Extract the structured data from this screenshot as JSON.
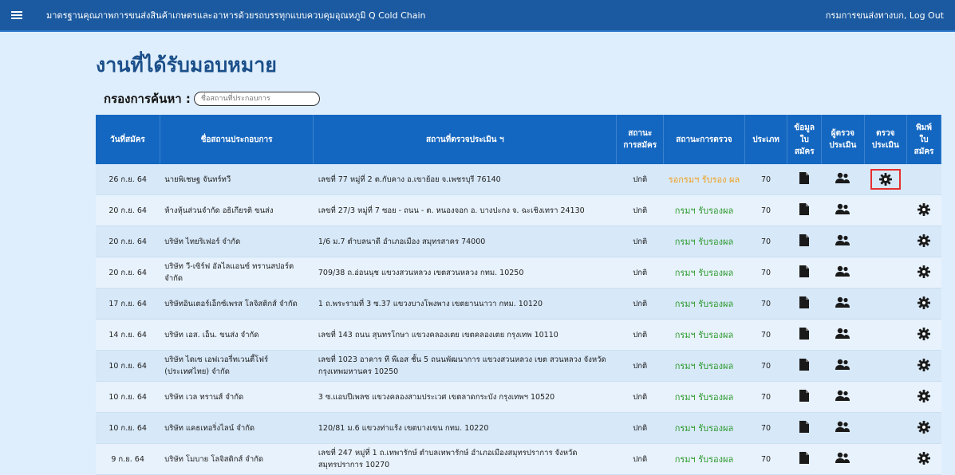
{
  "header": {
    "title": "มาตรฐานคุณภาพการขนส่งสินค้าเกษตรและอาหารด้วยรถบรรทุกแบบควบคุมอุณหภูมิ Q Cold Chain",
    "org": "กรมการขนส่งทางบก",
    "logout": "Log Out",
    "separator": ", "
  },
  "page": {
    "title": "งานที่ได้รับมอบหมาย",
    "filter_label": "กรองการค้นหา :",
    "search_placeholder": "ชื่อสถานที่ประกอบการ"
  },
  "table": {
    "headers": [
      "วันที่สมัคร",
      "ชื่อสถานประกอบการ",
      "สถานที่ตรวจประเมิน ฯ",
      "สถานะ การสมัคร",
      "สถานะการตรวจ",
      "ประเภท",
      "ข้อมูล ใบ สมัคร",
      "ผู้ตรวจ ประเมิน",
      "ตรวจ ประเมิน",
      "พิมพ์ ใบ สมัคร"
    ],
    "rows": [
      {
        "date": "26 ก.ย. 64",
        "company": "นายพิเชษฐ จันทร์ทวี",
        "address": "เลขที่ 77 หมู่ที่ 2 ต.กับคาง อ.เขาย้อย จ.เพชรบุรี 76140",
        "app_status": "ปกติ",
        "inspect_status": "รอกรมฯ รับรอง ผล",
        "type": "70",
        "can_inspect": true,
        "can_print": false
      },
      {
        "date": "20 ก.ย. 64",
        "company": "ห้างหุ้นส่วนจำกัด อธิเกียรติ ขนส่ง",
        "address": "เลขที่ 27/3 หมู่ที่ 7 ซอย - ถนน - ต. หนองจอก อ. บางปะกง จ. ฉะเชิงเทรา 24130",
        "app_status": "ปกติ",
        "inspect_status": "กรมฯ รับรองผล",
        "type": "70",
        "can_inspect": false,
        "can_print": true
      },
      {
        "date": "20 ก.ย. 64",
        "company": "บริษัท ไทยริเฟอร์ จำกัด",
        "address": "1/6 ม.7 ตำบลนาดี อำเภอเมือง สมุทรสาคร 74000",
        "app_status": "ปกติ",
        "inspect_status": "กรมฯ รับรองผล",
        "type": "70",
        "can_inspect": false,
        "can_print": true
      },
      {
        "date": "20 ก.ย. 64",
        "company": "บริษัท วี-เซิร์ฟ อัลไลแอนซ์ ทรานสปอร์ต จำกัด",
        "address": "709/38 ถ.อ่อนนุช แขวงสวนหลวง เขตสวนหลวง กทม. 10250",
        "app_status": "ปกติ",
        "inspect_status": "กรมฯ รับรองผล",
        "type": "70",
        "can_inspect": false,
        "can_print": true
      },
      {
        "date": "17 ก.ย. 64",
        "company": "บริษัทอินเตอร์เอ็กซ์เพรส โลจิสติกส์ จำกัด",
        "address": "1 ถ.พระรามที่ 3 ซ.37 แขวงบางโพงพาง เขตยานนาวา กทม. 10120",
        "app_status": "ปกติ",
        "inspect_status": "กรมฯ รับรองผล",
        "type": "70",
        "can_inspect": false,
        "can_print": true
      },
      {
        "date": "14 ก.ย. 64",
        "company": "บริษัท เอส. เอ็น. ขนส่ง จำกัด",
        "address": "เลขที่ 143 ถนน สุนทรโกษา แขวงคลองเตย เขตคลองเตย กรุงเทพ 10110",
        "app_status": "ปกติ",
        "inspect_status": "กรมฯ รับรองผล",
        "type": "70",
        "can_inspect": false,
        "can_print": true
      },
      {
        "date": "10 ก.ย. 64",
        "company": "บริษัท ไดเซ เอฟเวอรี่ทเวนตี้โฟร์ (ประเทศไทย) จำกัด",
        "address": "เลขที่ 1023 อาคาร ที พีเอส ชั้น 5 ถนนพัฒนาการ แขวงสวนหลวง เขต สวนหลวง จังหวัดกรุงเทพมหานคร 10250",
        "app_status": "ปกติ",
        "inspect_status": "กรมฯ รับรองผล",
        "type": "70",
        "can_inspect": false,
        "can_print": true
      },
      {
        "date": "10 ก.ย. 64",
        "company": "บริษัท เวล ทรานส์ จำกัด",
        "address": "3 ซ.แอบปีเพลซ แขวงคลองสามประเวศ เขตลาดกระบัง กรุงเทพฯ 10520",
        "app_status": "ปกติ",
        "inspect_status": "กรมฯ รับรองผล",
        "type": "70",
        "can_inspect": false,
        "can_print": true
      },
      {
        "date": "10 ก.ย. 64",
        "company": "บริษัท แคธเทอริ่งไลน์ จำกัด",
        "address": "120/81 ม.6 แขวงท่าแร้ง เขตบางเขน กทม. 10220",
        "app_status": "ปกติ",
        "inspect_status": "กรมฯ รับรองผล",
        "type": "70",
        "can_inspect": false,
        "can_print": true
      },
      {
        "date": "9 ก.ย. 64",
        "company": "บริษัท โมบาย โลจิสติกส์ จำกัด",
        "address": "เลขที่ 247 หมู่ที่ 1 ถ.เทพารักษ์ ตำบลเทพารักษ์ อำเภอเมืองสมุทรปราการ จังหวัดสมุทรปราการ 10270",
        "app_status": "ปกติ",
        "inspect_status": "กรมฯ รับรองผล",
        "type": "70",
        "can_inspect": false,
        "can_print": true
      }
    ]
  },
  "colors": {
    "header_bg": "#1b5aa0",
    "table_head_bg": "#1467c0",
    "status_green": "#2e9a2e",
    "status_orange": "#f0a020",
    "highlight": "#e53030"
  },
  "icons": {
    "doc": "document-icon",
    "people": "users-icon",
    "gear": "gear-icon",
    "menu": "hamburger-icon"
  }
}
